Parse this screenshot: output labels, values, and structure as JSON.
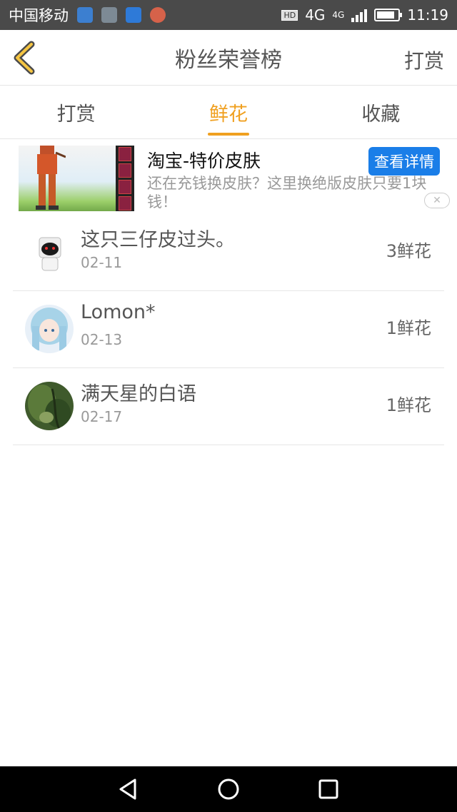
{
  "status_bar": {
    "carrier": "中国移动",
    "network": "4G",
    "network_small": "4G",
    "hd": "HD",
    "time": "11:19"
  },
  "header": {
    "title": "粉丝荣誉榜",
    "right_action": "打赏"
  },
  "tabs": [
    {
      "label": "打赏",
      "active": false
    },
    {
      "label": "鲜花",
      "active": true
    },
    {
      "label": "收藏",
      "active": false
    }
  ],
  "ad": {
    "title": "淘宝-特价皮肤",
    "button": "查看详情",
    "description": "还在充钱换皮肤？这里换绝版皮肤只要1块钱！"
  },
  "fans": [
    {
      "name": "这只三仔皮过头。",
      "date": "02-11",
      "amount": "3鲜花"
    },
    {
      "name": "Lomon*",
      "date": "02-13",
      "amount": "1鲜花"
    },
    {
      "name": "满天星的白语",
      "date": "02-17",
      "amount": "1鲜花"
    }
  ],
  "colors": {
    "accent": "#f0a020",
    "ad_button": "#1a7ee8",
    "status_bar": "#4a4a4a"
  }
}
